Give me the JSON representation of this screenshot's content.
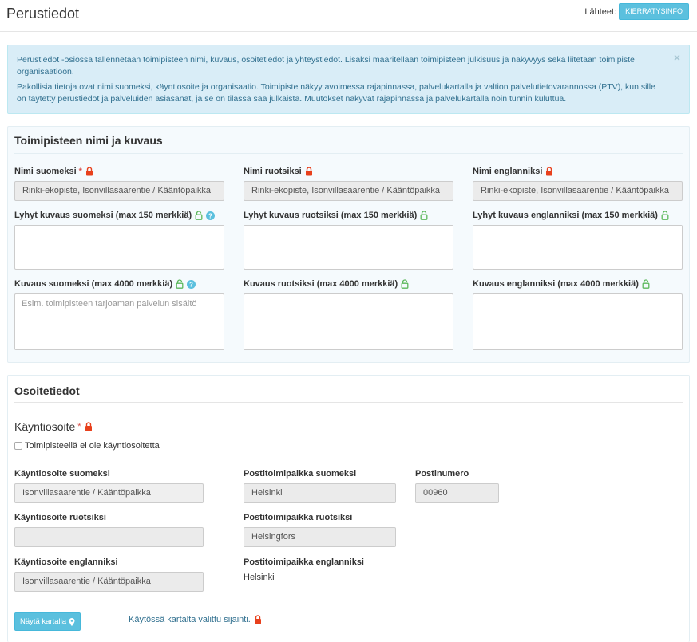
{
  "header": {
    "title": "Perustiedot",
    "sources_label": "Lähteet:",
    "sources_button": "KIERRATYSINFO"
  },
  "alert": {
    "paragraph1": "Perustiedot -osiossa tallennetaan toimipisteen nimi, kuvaus, osoitetiedot ja yhteystiedot. Lisäksi määritellään toimipisteen julkisuus ja näkyvyys sekä liitetään toimipiste organisaatioon.",
    "paragraph2": "Pakollisia tietoja ovat nimi suomeksi, käyntiosoite ja organisaatio. Toimipiste näkyy avoimessa rajapinnassa, palvelukartalla ja valtion palvelutietovarannossa (PTV), kun sille on täytetty perustiedot ja palveluiden asiasanat, ja se on tilassa saa julkaista. Muutokset näkyvät rajapinnassa ja palvelukartalla noin tunnin kuluttua.",
    "close": "×"
  },
  "name_section": {
    "title": "Toimipisteen nimi ja kuvaus",
    "name_fi_label": "Nimi suomeksi",
    "name_fi_value": "Rinki-ekopiste, Isonvillasaarentie / Kääntöpaikka",
    "name_sv_label": "Nimi ruotsiksi",
    "name_sv_value": "Rinki-ekopiste, Isonvillasaarentie / Kääntöpaikka",
    "name_en_label": "Nimi englanniksi",
    "name_en_value": "Rinki-ekopiste, Isonvillasaarentie / Kääntöpaikka",
    "short_fi_label": "Lyhyt kuvaus suomeksi (max 150 merkkiä)",
    "short_sv_label": "Lyhyt kuvaus ruotsiksi (max 150 merkkiä)",
    "short_en_label": "Lyhyt kuvaus englanniksi (max 150 merkkiä)",
    "desc_fi_label": "Kuvaus suomeksi (max 4000 merkkiä)",
    "desc_fi_placeholder": "Esim. toimipisteen tarjoaman palvelun sisältö",
    "desc_sv_label": "Kuvaus ruotsiksi (max 4000 merkkiä)",
    "desc_en_label": "Kuvaus englanniksi (max 4000 merkkiä)",
    "required_mark": "*"
  },
  "address_section": {
    "title": "Osoitetiedot",
    "visit_address_heading": "Käyntiosoite",
    "required_mark": "*",
    "no_visit_address_label": "Toimipisteellä ei ole käyntiosoitetta",
    "street_fi_label": "Käyntiosoite suomeksi",
    "street_fi_value": "Isonvillasaarentie / Kääntöpaikka",
    "city_fi_label": "Postitoimipaikka suomeksi",
    "city_fi_value": "Helsinki",
    "postal_label": "Postinumero",
    "postal_value": "00960",
    "street_sv_label": "Käyntiosoite ruotsiksi",
    "street_sv_value": "",
    "city_sv_label": "Postitoimipaikka ruotsiksi",
    "city_sv_value": "Helsingfors",
    "street_en_label": "Käyntiosoite englanniksi",
    "street_en_value": "Isonvillasaarentie / Kääntöpaikka",
    "city_en_label": "Postitoimipaikka englanniksi",
    "city_en_value": "Helsinki",
    "map_button": "Näytä kartalla",
    "map_note": "Käytössä kartalta valittu sijainti."
  },
  "colors": {
    "locked": "#e8401c",
    "unlocked": "#5cb85c",
    "info": "#5bc0de",
    "alert_text": "#31708f"
  },
  "icons": {
    "locked": "lock-closed-icon",
    "unlocked": "lock-open-icon",
    "help": "question-icon",
    "map_marker": "map-marker-icon"
  }
}
